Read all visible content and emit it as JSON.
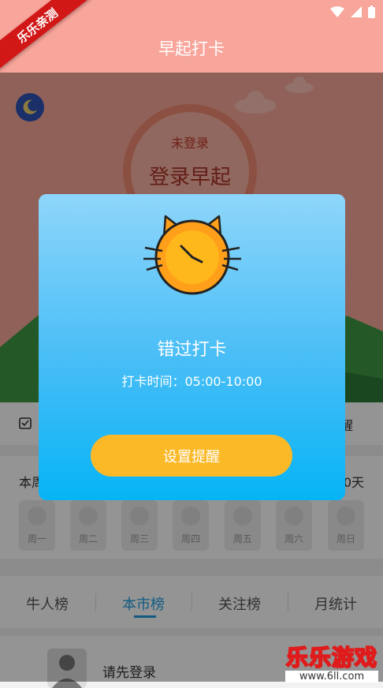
{
  "brand_ribbon": "乐乐亲测",
  "header": {
    "title": "早起打卡"
  },
  "hero": {
    "ring_status": "未登录",
    "ring_action": "登录早起"
  },
  "row1": {
    "remind_partial": "醒"
  },
  "week": {
    "label": "本周",
    "count_partial": "0天",
    "days": [
      "周一",
      "周二",
      "周三",
      "周四",
      "周五",
      "周六",
      "周日"
    ]
  },
  "tabs": [
    {
      "label": "牛人榜"
    },
    {
      "label": "本市榜"
    },
    {
      "label": "关注榜"
    },
    {
      "label": "月统计"
    }
  ],
  "list": {
    "login_prompt": "请先登录"
  },
  "watermark": {
    "title": "乐乐游戏",
    "url": "www.6ll.com"
  },
  "modal": {
    "title": "错过打卡",
    "time_text": "打卡时间：05:00-10:00",
    "button_label": "设置提醒"
  },
  "colors": {
    "header_bg": "#f8a59b",
    "modal_gradient_top": "#8ed6fb",
    "modal_gradient_bottom": "#06b4f6",
    "button_bg": "#fbb928",
    "active_tab": "#1f9fe0"
  },
  "icons": [
    "wifi-icon",
    "signal-icon",
    "battery-icon",
    "moon-icon",
    "clock-cat-icon",
    "calendar-icon",
    "avatar-icon"
  ]
}
